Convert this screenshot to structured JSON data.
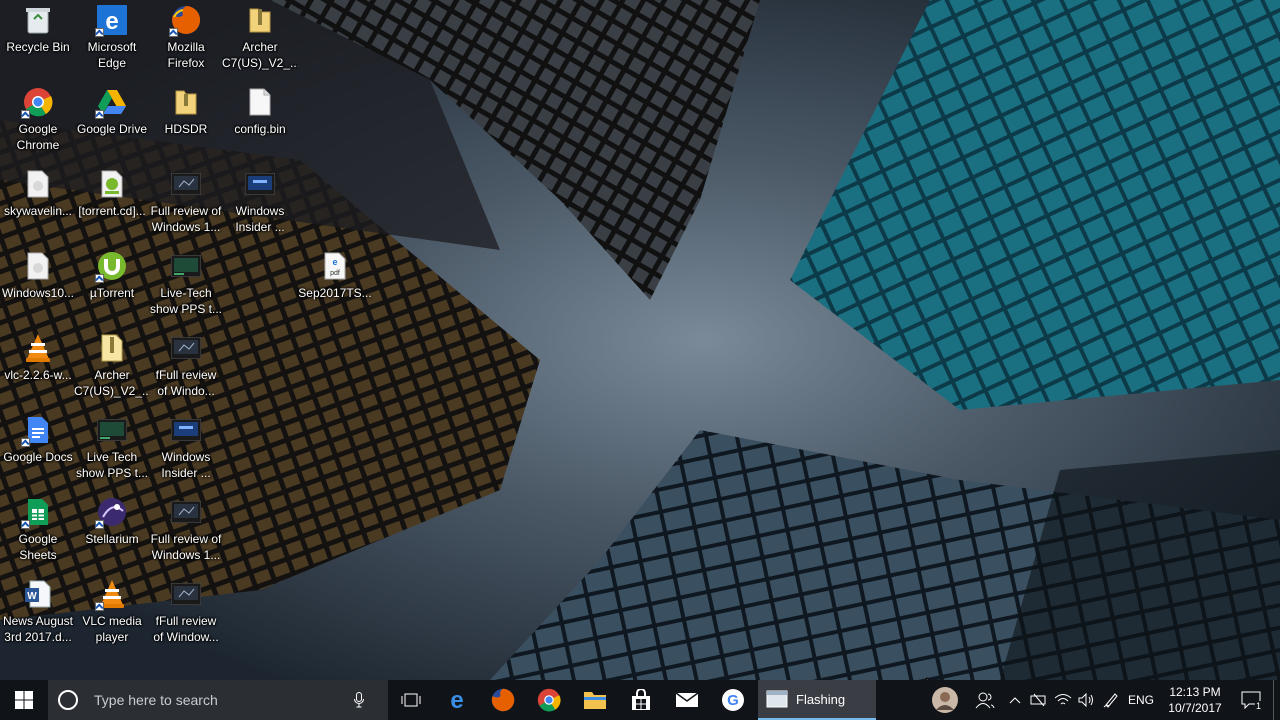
{
  "desktop": {
    "icons": [
      {
        "label": "Recycle Bin",
        "icon": "recycle-bin-icon"
      },
      {
        "label": "Microsoft\nEdge",
        "icon": "edge-icon"
      },
      {
        "label": "Mozilla\nFirefox",
        "icon": "firefox-icon"
      },
      {
        "label": "Archer\nC7(US)_V2_...",
        "icon": "zip-folder-icon"
      },
      {
        "label": "Google\nChrome",
        "icon": "chrome-icon"
      },
      {
        "label": "Google Drive",
        "icon": "google-drive-icon"
      },
      {
        "label": "HDSDR",
        "icon": "folder-icon"
      },
      {
        "label": "config.bin",
        "icon": "file-icon"
      },
      {
        "label": "skywavelin...",
        "icon": "file-icon"
      },
      {
        "label": "[torrent.cd]...",
        "icon": "torrent-file-icon"
      },
      {
        "label": "Full review of\nWindows 1...",
        "icon": "video-icon"
      },
      {
        "label": "Windows\nInsider ...",
        "icon": "video-icon"
      },
      {
        "label": "Windows10...",
        "icon": "file-icon"
      },
      {
        "label": "µTorrent",
        "icon": "utorrent-icon"
      },
      {
        "label": "Live-Tech\nshow PPS t...",
        "icon": "video-icon"
      },
      {
        "label": "Sep2017TS...",
        "icon": "pdf-icon"
      },
      {
        "label": "vlc-2.2.6-w...",
        "icon": "vlc-icon"
      },
      {
        "label": "Archer\nC7(US)_V2_...",
        "icon": "zip-file-icon"
      },
      {
        "label": "fFull review\nof Windo...",
        "icon": "video-icon"
      },
      {
        "label": "Google Docs",
        "icon": "google-docs-icon"
      },
      {
        "label": "Live Tech\nshow PPS t...",
        "icon": "video-icon"
      },
      {
        "label": "Windows\nInsider ...",
        "icon": "video-icon"
      },
      {
        "label": "Google\nSheets",
        "icon": "google-sheets-icon"
      },
      {
        "label": "Stellarium",
        "icon": "stellarium-icon"
      },
      {
        "label": "Full review of\nWindows 1...",
        "icon": "video-icon"
      },
      {
        "label": "News August\n3rd 2017.d...",
        "icon": "word-doc-icon"
      },
      {
        "label": "VLC media\nplayer",
        "icon": "vlc-icon"
      },
      {
        "label": "fFull review\nof Window...",
        "icon": "video-icon"
      }
    ]
  },
  "taskbar": {
    "search_placeholder": "Type here to search",
    "pinned": [
      "task-view-icon",
      "edge-icon",
      "firefox-icon",
      "chrome-icon",
      "file-explorer-icon",
      "store-icon",
      "mail-icon",
      "google-icon"
    ],
    "open_app_label": "Flashing",
    "language": "ENG",
    "time": "12:13 PM",
    "date": "10/7/2017",
    "notifications_count": "1"
  },
  "colors": {
    "taskbar_bg": "#101318",
    "search_bg": "#2b2e33",
    "accent": "#76b9ed"
  }
}
